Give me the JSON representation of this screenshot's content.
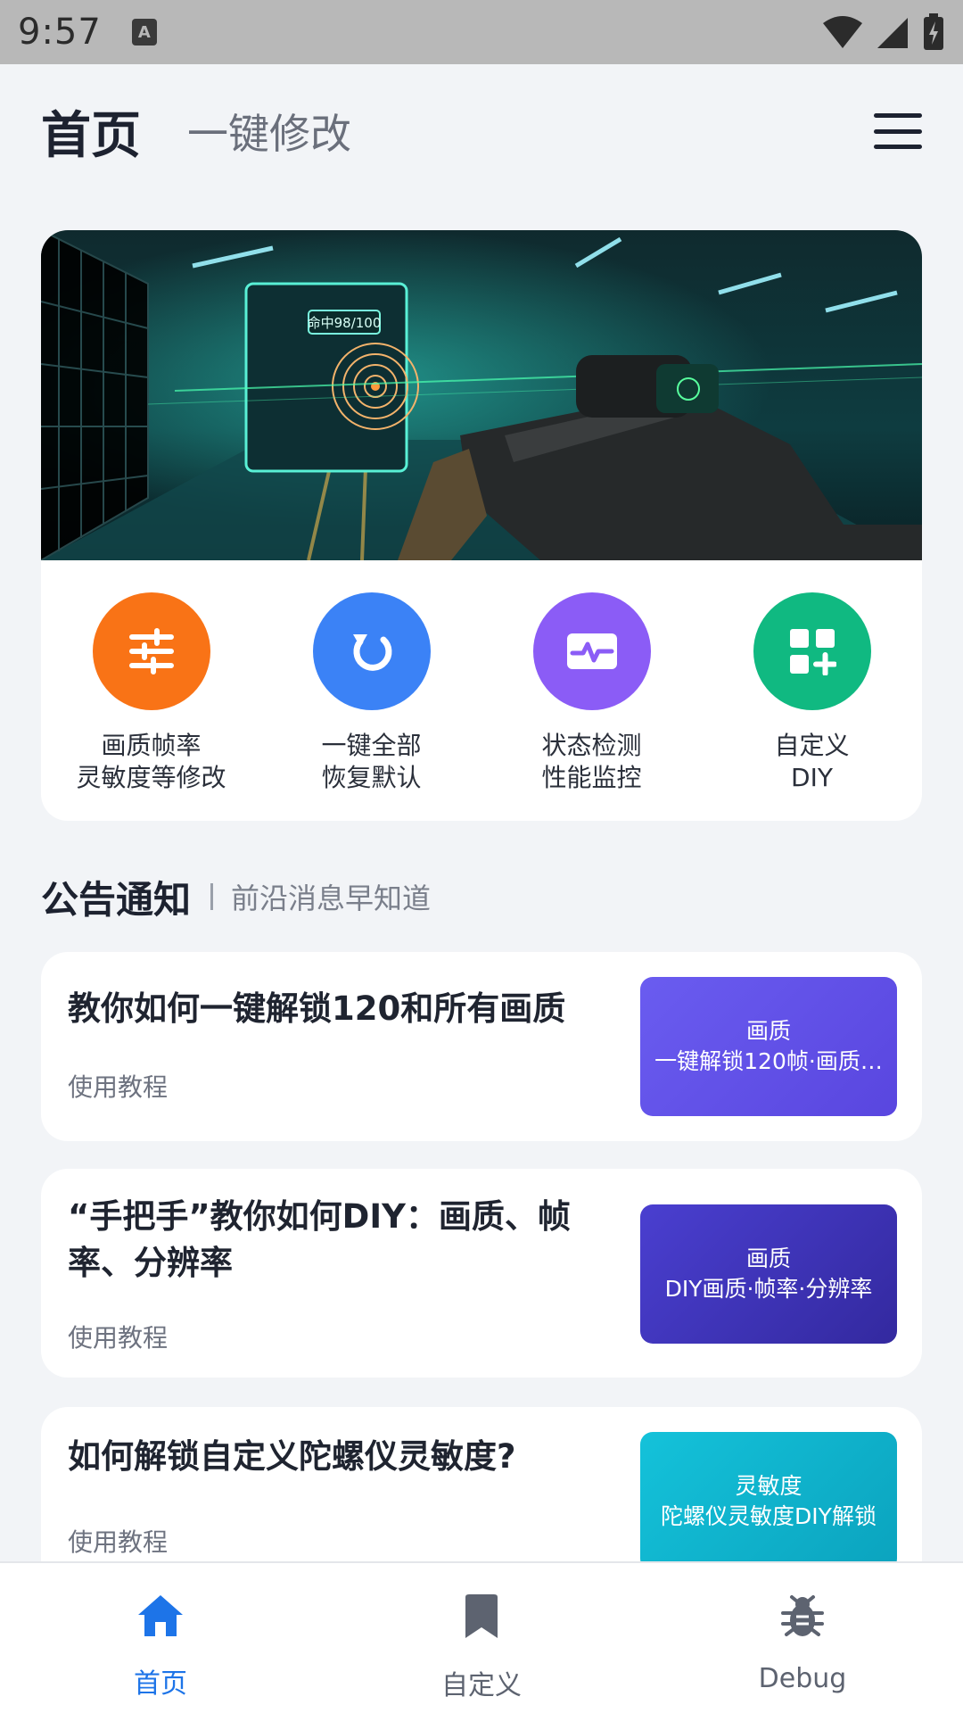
{
  "status_bar": {
    "time": "9:57",
    "notification_icon": "A"
  },
  "header": {
    "title": "首页",
    "subtitle": "一键修改"
  },
  "hero": {
    "banner_text": "命中98/100"
  },
  "actions": [
    {
      "label_line1": "画质帧率",
      "label_line2": "灵敏度等修改",
      "color": "#f97316",
      "icon": "sliders-icon"
    },
    {
      "label_line1": "一键全部",
      "label_line2": "恢复默认",
      "color": "#3b82f6",
      "icon": "reset-icon"
    },
    {
      "label_line1": "状态检测",
      "label_line2": "性能监控",
      "color": "#8b5cf6",
      "icon": "pulse-icon"
    },
    {
      "label_line1": "自定义",
      "label_line2": "DIY",
      "color": "#10b981",
      "icon": "add-grid-icon"
    }
  ],
  "section": {
    "title": "公告通知",
    "subtitle": "前沿消息早知道"
  },
  "notices": [
    {
      "title": "教你如何一键解锁120和所有画质",
      "tag": "使用教程",
      "thumb_category": "画质",
      "thumb_desc": "一键解锁120帧·画质…",
      "thumb_color": "#6155e8"
    },
    {
      "title": "“手把手”教你如何DIY：画质、帧率、分辨率",
      "tag": "使用教程",
      "thumb_category": "画质",
      "thumb_desc": "DIY画质·帧率·分辨率",
      "thumb_color": "#3f36c2"
    },
    {
      "title": "如何解锁自定义陀螺仪灵敏度?",
      "tag": "使用教程",
      "thumb_category": "灵敏度",
      "thumb_desc": "陀螺仪灵敏度DIY解锁",
      "thumb_color": "#0fb3cf"
    }
  ],
  "bottom_nav": [
    {
      "label": "首页",
      "icon": "home-icon",
      "active": true
    },
    {
      "label": "自定义",
      "icon": "bookmark-icon",
      "active": false
    },
    {
      "label": "Debug",
      "icon": "bug-icon",
      "active": false
    }
  ],
  "colors": {
    "accent": "#1d74e8",
    "inactive": "#5d6370"
  }
}
